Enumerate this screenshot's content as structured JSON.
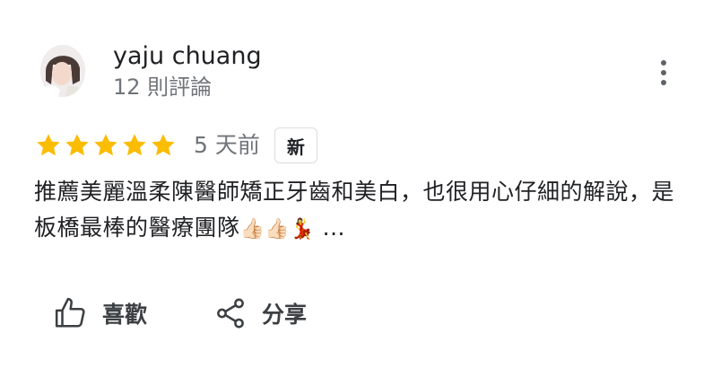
{
  "reviewer": {
    "name": "yaju chuang",
    "review_count": "12 則評論"
  },
  "rating": {
    "stars": 5,
    "time": "5 天前",
    "badge": "新",
    "star_color": "#fbbc04"
  },
  "review": {
    "text": "推薦美麗溫柔陳醫師矯正牙齒和美白，也很用心仔細的解說，是板橋最棒的醫療團隊",
    "emojis": "👍🏻👍🏻💃",
    "ellipsis": "..."
  },
  "actions": {
    "like_label": "喜歡",
    "share_label": "分享"
  }
}
